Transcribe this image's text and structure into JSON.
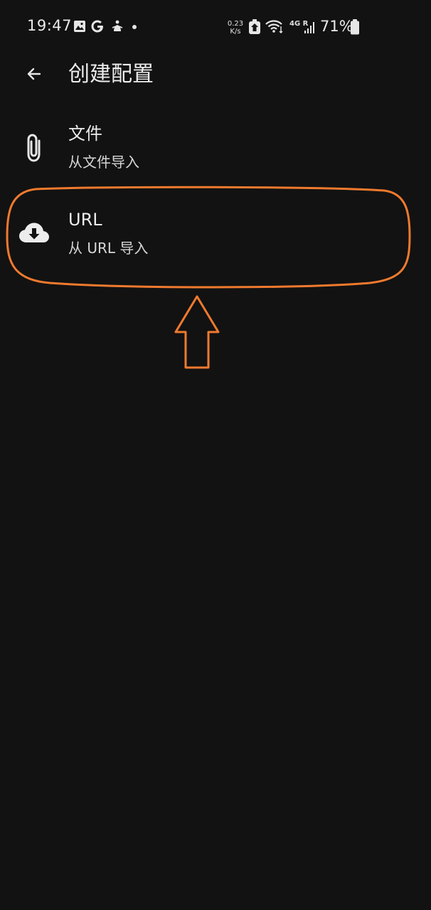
{
  "status_bar": {
    "time": "19:47",
    "net_speed_value": "0.23",
    "net_speed_unit": "K/s",
    "network_type": "4G R",
    "battery_percent": "71%",
    "notification_icons": [
      "gallery-icon",
      "google-icon",
      "app-icon",
      "dot-icon"
    ],
    "system_icons": [
      "vpn-icon",
      "wifi-icon",
      "signal-icon",
      "battery-icon"
    ]
  },
  "app_bar": {
    "title": "创建配置",
    "back_icon": "arrow-back-icon"
  },
  "options": [
    {
      "icon": "paperclip-icon",
      "title": "文件",
      "subtitle": "从文件导入"
    },
    {
      "icon": "cloud-download-icon",
      "title": "URL",
      "subtitle": "从 URL 导入"
    }
  ],
  "annotation": {
    "color": "#f07a2e"
  },
  "colors": {
    "background": "#121212",
    "text_primary": "#ececec",
    "text_secondary": "#d6d6d6"
  }
}
